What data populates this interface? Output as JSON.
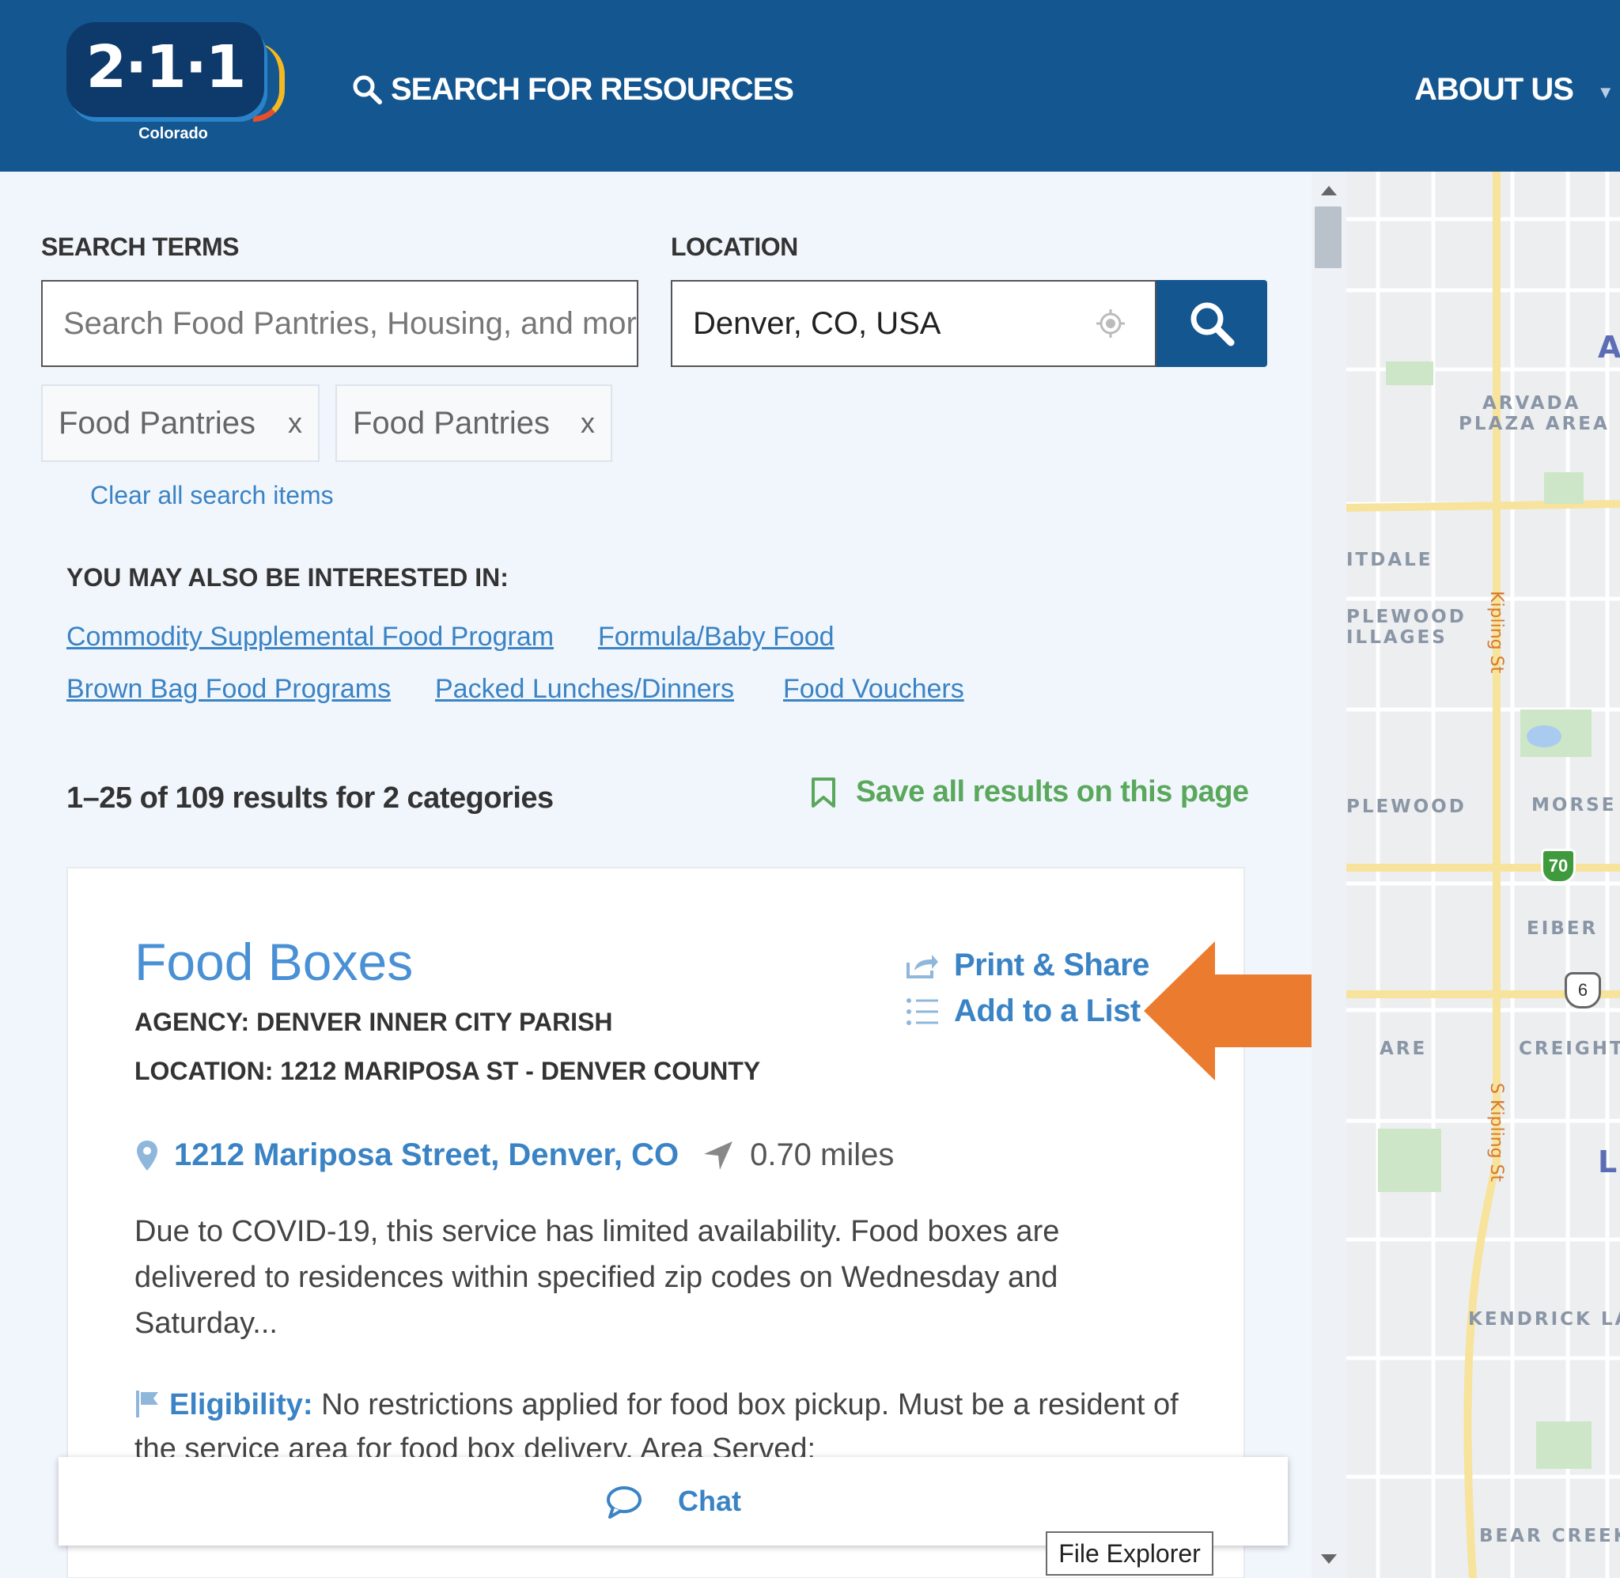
{
  "header": {
    "logo_number": "2·1·1",
    "logo_sub": "Colorado",
    "nav_search": "SEARCH FOR RESOURCES",
    "nav_about": "ABOUT US",
    "colors": {
      "header_bg": "#14568f",
      "link": "#3a83c5",
      "accent_green": "#5aa85c",
      "arrow": "#ea7b2f"
    }
  },
  "search": {
    "terms_label": "SEARCH TERMS",
    "terms_placeholder": "Search Food Pantries, Housing, and more",
    "location_label": "LOCATION",
    "location_value": "Denver, CO, USA",
    "submit_icon": "search-icon",
    "chips": [
      {
        "label": "Food Pantries",
        "remove": "x"
      },
      {
        "label": "Food Pantries",
        "remove": "x"
      }
    ],
    "clear_label": "Clear all search items"
  },
  "related": {
    "heading": "YOU MAY ALSO BE INTERESTED IN:",
    "links": [
      "Commodity Supplemental Food Program",
      "Formula/Baby Food",
      "Brown Bag Food Programs",
      "Packed Lunches/Dinners",
      "Food Vouchers"
    ]
  },
  "results": {
    "count_text": "1–25 of 109 results for 2 categories",
    "save_all_label": "Save all results on this page"
  },
  "card": {
    "title": "Food Boxes",
    "agency": "AGENCY: DENVER INNER CITY PARISH",
    "location": "LOCATION: 1212 MARIPOSA ST - DENVER COUNTY",
    "print_share": "Print & Share",
    "add_list": "Add to a List",
    "address": "1212 Mariposa Street, Denver, CO",
    "distance": "0.70 miles",
    "description": "Due to COVID-19, this service has limited availability. Food boxes are delivered to residences within specified zip codes on Wednesday and Saturday...",
    "eligibility_label": "Eligibility:",
    "eligibility_text": "No restrictions applied for food box pickup. Must be a resident of the service area for food box delivery. Area Served:"
  },
  "map": {
    "labels": [
      "Ar",
      "ARVADA",
      "PLAZA AREA",
      "ITDALE",
      "PLEWOOD",
      "ILLAGES",
      "PLEWOOD",
      "MORSE",
      "EIBER",
      "ARE",
      "CREIGHT",
      "L",
      "KENDRICK LA",
      "BEAR CREEK"
    ],
    "streets": [
      "Kipling St",
      "S Kipling St"
    ],
    "shields": [
      "70",
      "6"
    ]
  },
  "chat": {
    "label": "Chat"
  },
  "tooltip": {
    "text": "File Explorer"
  }
}
